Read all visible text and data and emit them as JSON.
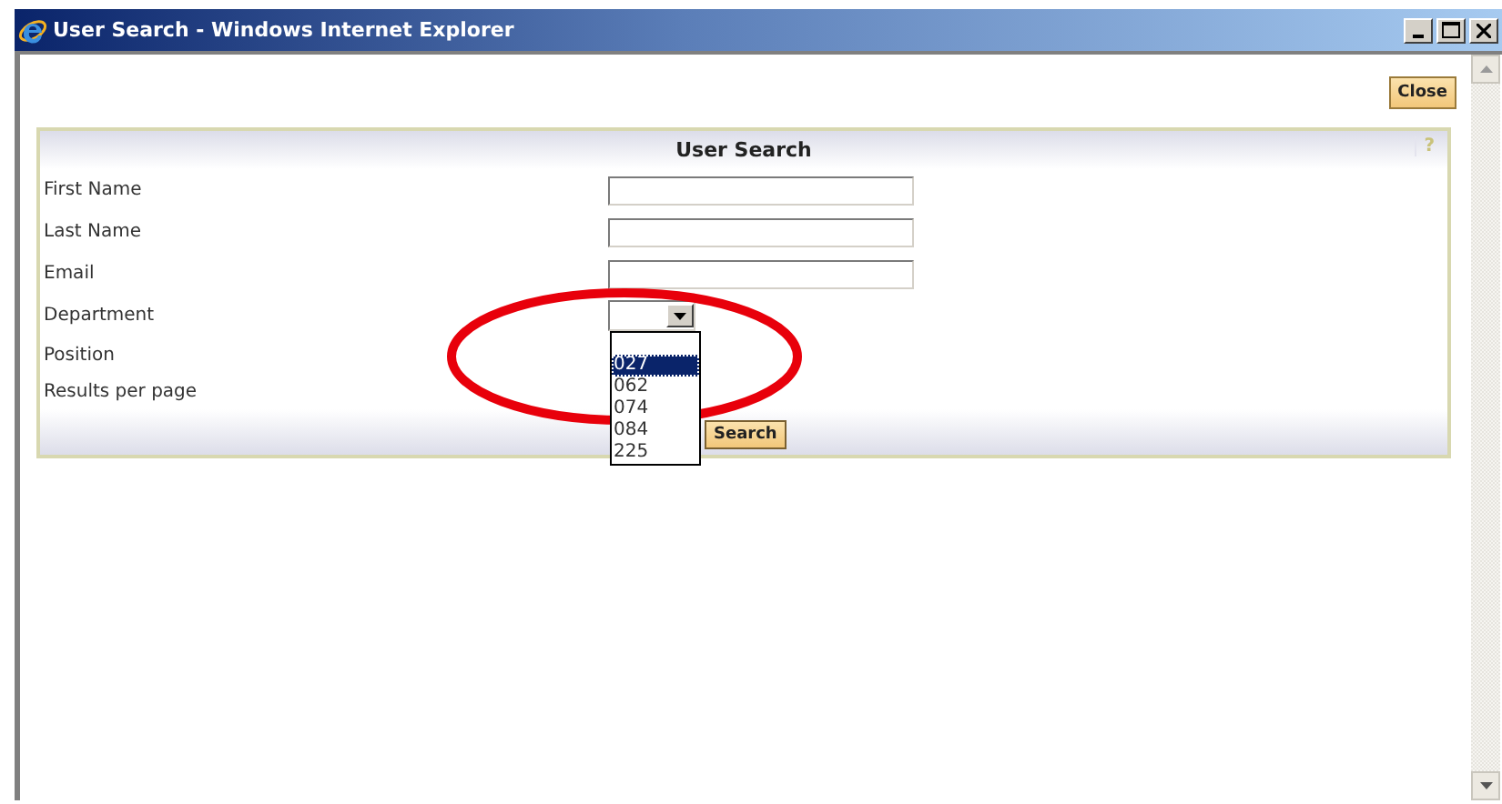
{
  "window": {
    "title": "User Search - Windows Internet Explorer"
  },
  "close_button": "Close",
  "panel": {
    "title": "User Search",
    "help": "?"
  },
  "fields": [
    {
      "kind": "text",
      "label": "First Name"
    },
    {
      "kind": "text",
      "label": "Last Name"
    },
    {
      "kind": "text",
      "label": "Email"
    },
    {
      "kind": "select",
      "label": "Department"
    },
    {
      "kind": "blank",
      "label": "Position"
    },
    {
      "kind": "blank",
      "label": "Results per page"
    }
  ],
  "dropdown": {
    "options": [
      {
        "label": "027",
        "selected": true
      },
      {
        "label": "062",
        "selected": false
      },
      {
        "label": "074",
        "selected": false
      },
      {
        "label": "084",
        "selected": false
      },
      {
        "label": "225",
        "selected": false
      }
    ]
  },
  "search_button": "Search",
  "annotation": {
    "kind": "ellipse"
  }
}
